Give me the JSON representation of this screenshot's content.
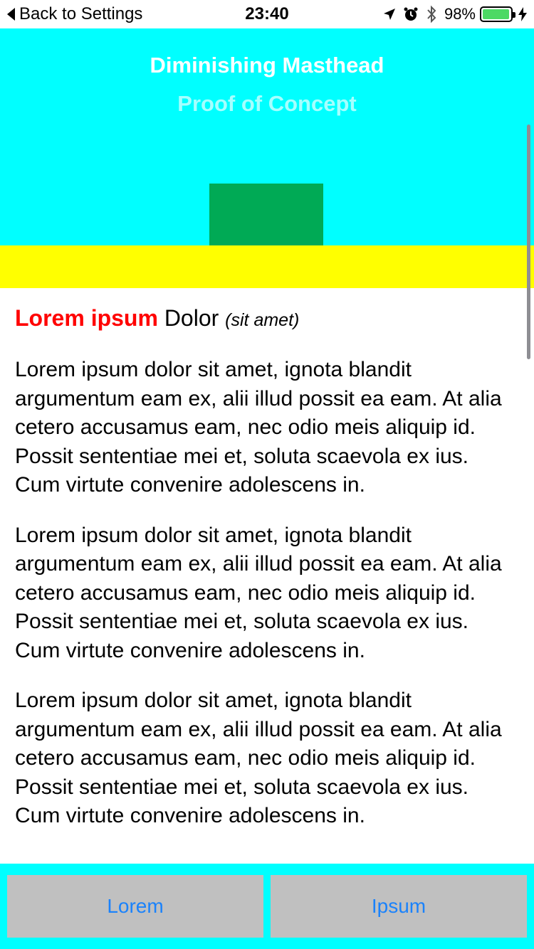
{
  "status_bar": {
    "back_label": "Back to Settings",
    "time": "23:40",
    "battery_percent": "98%",
    "battery_level": 0.98,
    "icons": [
      "location-arrow-icon",
      "alarm-clock-icon",
      "bluetooth-icon",
      "battery-icon",
      "charging-bolt-icon"
    ]
  },
  "masthead": {
    "title": "Diminishing Masthead",
    "subtitle": "Proof of Concept"
  },
  "article": {
    "heading_red": "Lorem ipsum",
    "heading_plain": "Dolor",
    "heading_italic": "(sit amet)",
    "paragraphs": [
      "Lorem ipsum dolor sit amet, ignota blandit argumentum eam ex, alii illud possit ea eam. At alia cetero accusamus eam, nec odio meis aliquip id. Possit sententiae mei et, soluta scaevola ex ius. Cum virtute convenire adolescens in.",
      "Lorem ipsum dolor sit amet, ignota blandit argumentum eam ex, alii illud possit ea eam. At alia cetero accusamus eam, nec odio meis aliquip id. Possit sententiae mei et, soluta scaevola ex ius. Cum virtute convenire adolescens in.",
      "Lorem ipsum dolor sit amet, ignota blandit argumentum eam ex, alii illud possit ea eam. At alia cetero accusamus eam, nec odio meis aliquip id. Possit sententiae mei et, soluta scaevola ex ius. Cum virtute convenire adolescens in."
    ]
  },
  "bottom_bar": {
    "left_label": "Lorem",
    "right_label": "Ipsum"
  },
  "colors": {
    "masthead_bg": "#00ffff",
    "block_green": "#00aa55",
    "band_yellow": "#ffff00",
    "heading_red": "#ff0000",
    "button_gray": "#c0c0c0",
    "button_text": "#1a82fb",
    "bottom_bar_bg": "#00ffff"
  }
}
